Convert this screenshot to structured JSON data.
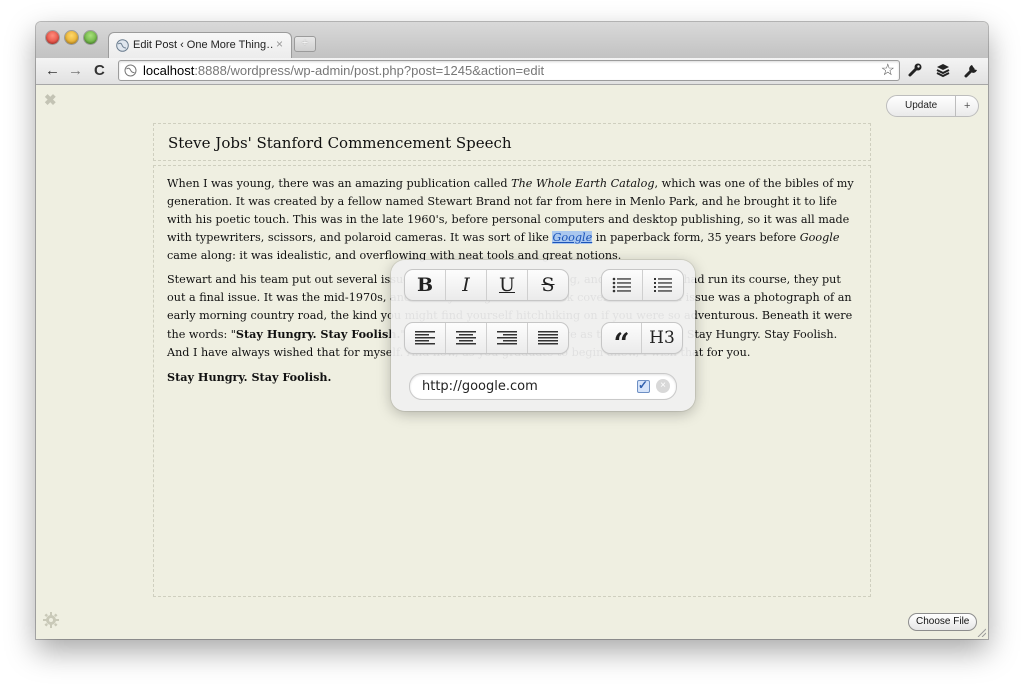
{
  "browser": {
    "tab_title": "Edit Post ‹ One More Thing…",
    "tab_close": "×",
    "new_tab": "+",
    "back": "←",
    "forward": "→",
    "reload": "C",
    "url_host": "localhost",
    "url_path": ":8888/wordpress/wp-admin/post.php?post=1245&action=edit",
    "star": "☆"
  },
  "editor": {
    "close": "✖",
    "update_label": "Update",
    "update_plus": "+",
    "post_title": "Steve Jobs' Stanford Commencement Speech",
    "p1_a": "When I was young, there was an amazing publication called ",
    "p1_em": "The Whole Earth Catalog",
    "p1_b": ", which was one of the bibles of my generation. It was created by a fellow named Stewart Brand not far from here in Menlo Park, and he brought it to life with his poetic touch. This was in the late 1960's, before personal computers and desktop publishing, so it was all made with typewriters, scissors, and polaroid cameras. It was sort of like ",
    "p1_link": "Google",
    "p1_c": " in paperback form, 35 years before ",
    "p1_em2": "Google",
    "p1_d": " came along: it was idealistic, and overflowing with neat tools and great notions.",
    "p2_a": "Stewart and his team put out several issues of The Whole Earth Catalog, and then when it had run its course, they put out a final issue. It was the mid-1970s, and I was your age. On the back cover of their final issue was a photograph of an early morning country road, the kind you might find yourself hitchhiking on if you were so adventurous. Beneath it were the words: \"",
    "p2_strong": "Stay Hungry. Stay Foolish.",
    "p2_b": "\" It was their farewell message as they signed off. Stay Hungry. Stay Foolish. And I have always wished that for myself. And now, as you graduate to begin anew, I wish that for you.",
    "p3_strong": "Stay Hungry. Stay Foolish.",
    "choose_file": "Choose File"
  },
  "popover": {
    "bold": "B",
    "italic": "I",
    "underline": "U",
    "strike": "S",
    "quote": "“",
    "heading": "H3",
    "link_url": "http://google.com"
  }
}
